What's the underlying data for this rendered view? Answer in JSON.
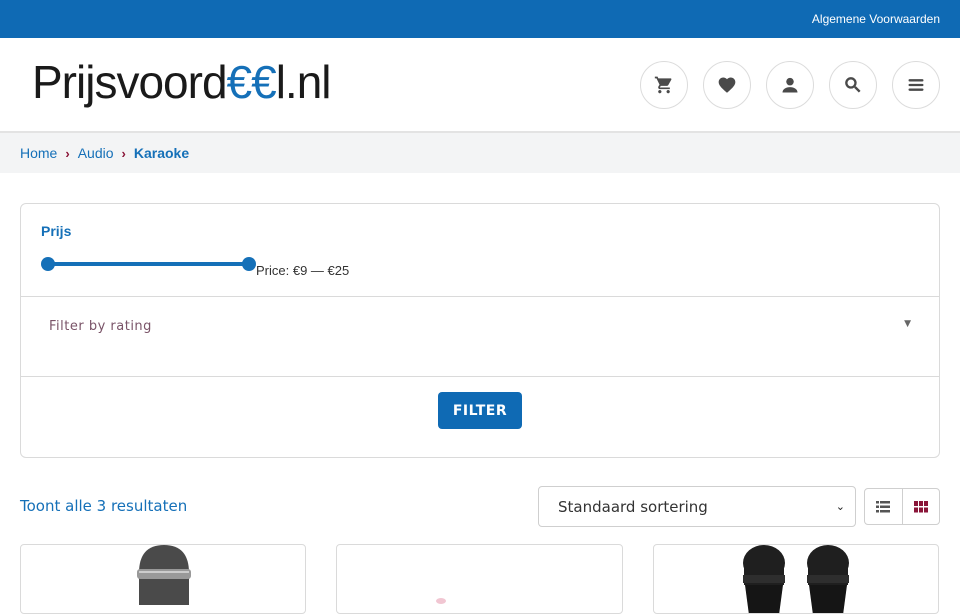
{
  "topbar": {
    "terms_link": "Algemene Voorwaarden"
  },
  "header": {
    "logo_part1": "Prijs",
    "logo_part2": "voord",
    "logo_part3": "€€",
    "logo_part4": "l.nl",
    "icons": [
      "cart-icon",
      "heart-icon",
      "user-icon",
      "search-icon",
      "menu-icon"
    ]
  },
  "breadcrumb": {
    "home": "Home",
    "audio": "Audio",
    "current": "Karaoke",
    "separator": "›"
  },
  "filter": {
    "price_title": "Prijs",
    "price_label": "Price: €9 — €25",
    "price_min": 9,
    "price_max": 25,
    "rating_placeholder": "Filter by rating",
    "button_label": "FILTER"
  },
  "results": {
    "text": "Toont alle 3 resultaten"
  },
  "sort": {
    "selected": "Standaard sortering"
  },
  "view": {
    "active": "grid"
  },
  "colors": {
    "primary": "#0f6ab4",
    "accent": "#8a1538"
  }
}
